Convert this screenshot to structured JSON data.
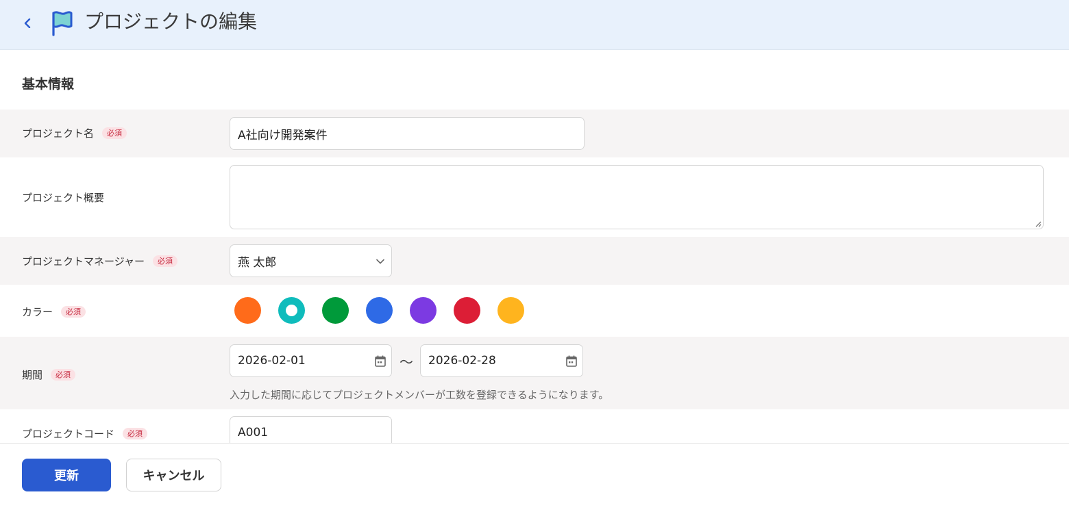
{
  "header": {
    "title": "プロジェクトの編集"
  },
  "section": {
    "title": "基本情報"
  },
  "required_badge": "必須",
  "fields": {
    "project_name": {
      "label": "プロジェクト名",
      "value": "A社向け開発案件"
    },
    "project_summary": {
      "label": "プロジェクト概要",
      "value": ""
    },
    "project_manager": {
      "label": "プロジェクトマネージャー",
      "value": "燕 太郎"
    },
    "color": {
      "label": "カラー",
      "options": [
        "#ff6b1a",
        "#0fbcbc",
        "#009a3a",
        "#2e6ae6",
        "#7c3ae2",
        "#dc1e36",
        "#ffb41e"
      ],
      "selected": "#0fbcbc"
    },
    "period": {
      "label": "期間",
      "start": "2026-02-01",
      "separator": "～",
      "end": "2026-02-28",
      "hint": "入力した期間に応じてプロジェクトメンバーが工数を登録できるようになります。"
    },
    "project_code": {
      "label": "プロジェクトコード",
      "value": "A001"
    }
  },
  "buttons": {
    "update": "更新",
    "cancel": "キャンセル"
  },
  "icons": {
    "back": "chevron-left-icon",
    "flag": "flag-icon",
    "dropdown": "chevron-down-icon",
    "calendar": "calendar-icon"
  },
  "colors": {
    "accent": "#2a5bd0",
    "header_bg": "#e8f1fc",
    "required_bg": "#fbe1e4",
    "required_text": "#c62a3f"
  }
}
